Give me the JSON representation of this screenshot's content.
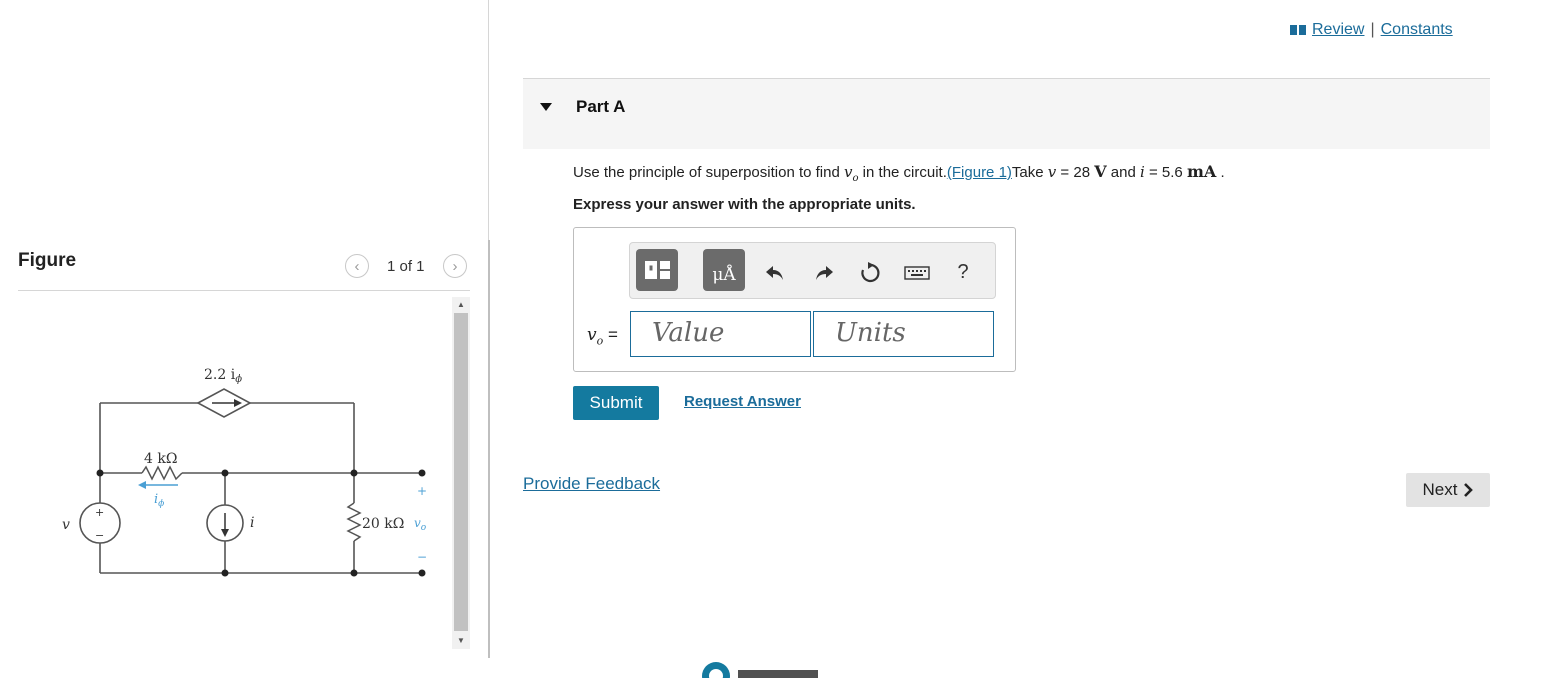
{
  "figure_panel": {
    "title": "Figure",
    "pager": "1 of 1",
    "circuit": {
      "dep_source": "2.2 i",
      "dep_source_sub": "ϕ",
      "resistor1": "4 kΩ",
      "current_label": "i",
      "current_label_sub": "ϕ",
      "v_source": "v",
      "plus": "+",
      "minus": "−",
      "current_source": "i",
      "resistor2": "20 kΩ",
      "vo": "v",
      "vo_sub": "o"
    }
  },
  "header": {
    "review": "Review",
    "separator": "|",
    "constants": "Constants"
  },
  "part": {
    "title": "Part A",
    "q_pre": "Use the principle of superposition to find ",
    "q_var": "v",
    "q_var_sub": "o",
    "q_mid": " in the circuit.",
    "figure_link": "(Figure 1)",
    "q_take": "Take ",
    "v_sym": "v",
    "v_eq": " = 28 ",
    "v_unit": "V",
    "and_text": " and ",
    "i_sym": "i",
    "i_eq": " = 5.6 ",
    "i_unit": "mA",
    "q_end": " .",
    "instruction": "Express your answer with the appropriate units.",
    "answer_label": "v",
    "answer_label_sub": "o",
    "answer_eq": " =",
    "value_placeholder": "Value",
    "units_placeholder": "Units",
    "unit_button": "μÅ",
    "help": "?"
  },
  "actions": {
    "submit": "Submit",
    "request_answer": "Request Answer",
    "provide_feedback": "Provide Feedback",
    "next": "Next"
  },
  "colors": {
    "accent": "#147a9f",
    "link": "#1b6c9a",
    "toolbar_button": "#6b6b6b"
  }
}
